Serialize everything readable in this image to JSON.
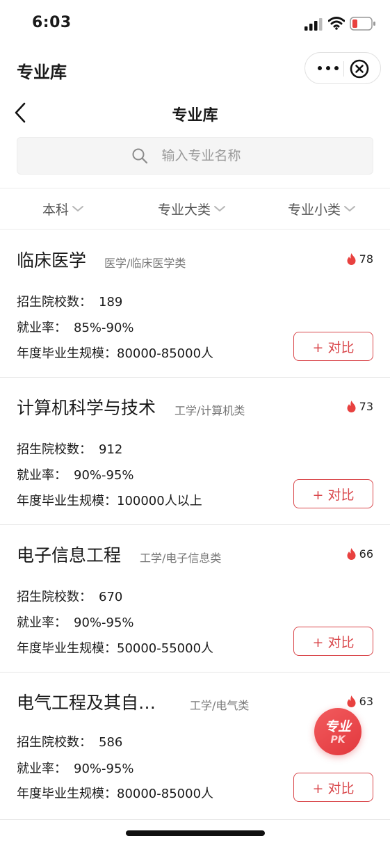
{
  "status_bar": {
    "time": "6:03"
  },
  "mini_program": {
    "title": "专业库"
  },
  "nav": {
    "title": "专业库"
  },
  "search": {
    "placeholder": "输入专业名称"
  },
  "filters": [
    {
      "label": "本科"
    },
    {
      "label": "专业大类"
    },
    {
      "label": "专业小类"
    }
  ],
  "stat_labels": {
    "schools": "招生院校数：",
    "employment": "就业率：",
    "graduates": "年度毕业生规模："
  },
  "compare_label": "+ 对比",
  "majors": [
    {
      "name": "临床医学",
      "category": "医学/临床医学类",
      "hot": "78",
      "schools": "189",
      "employment": "85%-90%",
      "graduates": "80000-85000人"
    },
    {
      "name": "计算机科学与技术",
      "category": "工学/计算机类",
      "hot": "73",
      "schools": "912",
      "employment": "90%-95%",
      "graduates": "100000人以上"
    },
    {
      "name": "电子信息工程",
      "category": "工学/电子信息类",
      "hot": "66",
      "schools": "670",
      "employment": "90%-95%",
      "graduates": "50000-55000人"
    },
    {
      "name": "电气工程及其自…",
      "category": "工学/电气类",
      "hot": "63",
      "schools": "586",
      "employment": "90%-95%",
      "graduates": "80000-85000人"
    }
  ],
  "pk_button": {
    "line1": "专业",
    "line2": "PK"
  },
  "colors": {
    "accent": "#d9474b",
    "hot_flame": "#e8413f",
    "muted_text": "#777777"
  },
  "icons": {
    "signal": "signal-icon",
    "wifi": "wifi-icon",
    "battery": "battery-icon",
    "more": "more-dots-icon",
    "close": "close-circle-icon",
    "back": "chevron-left-icon",
    "search": "search-icon",
    "dropdown": "chevron-down-icon",
    "hot": "flame-icon"
  }
}
